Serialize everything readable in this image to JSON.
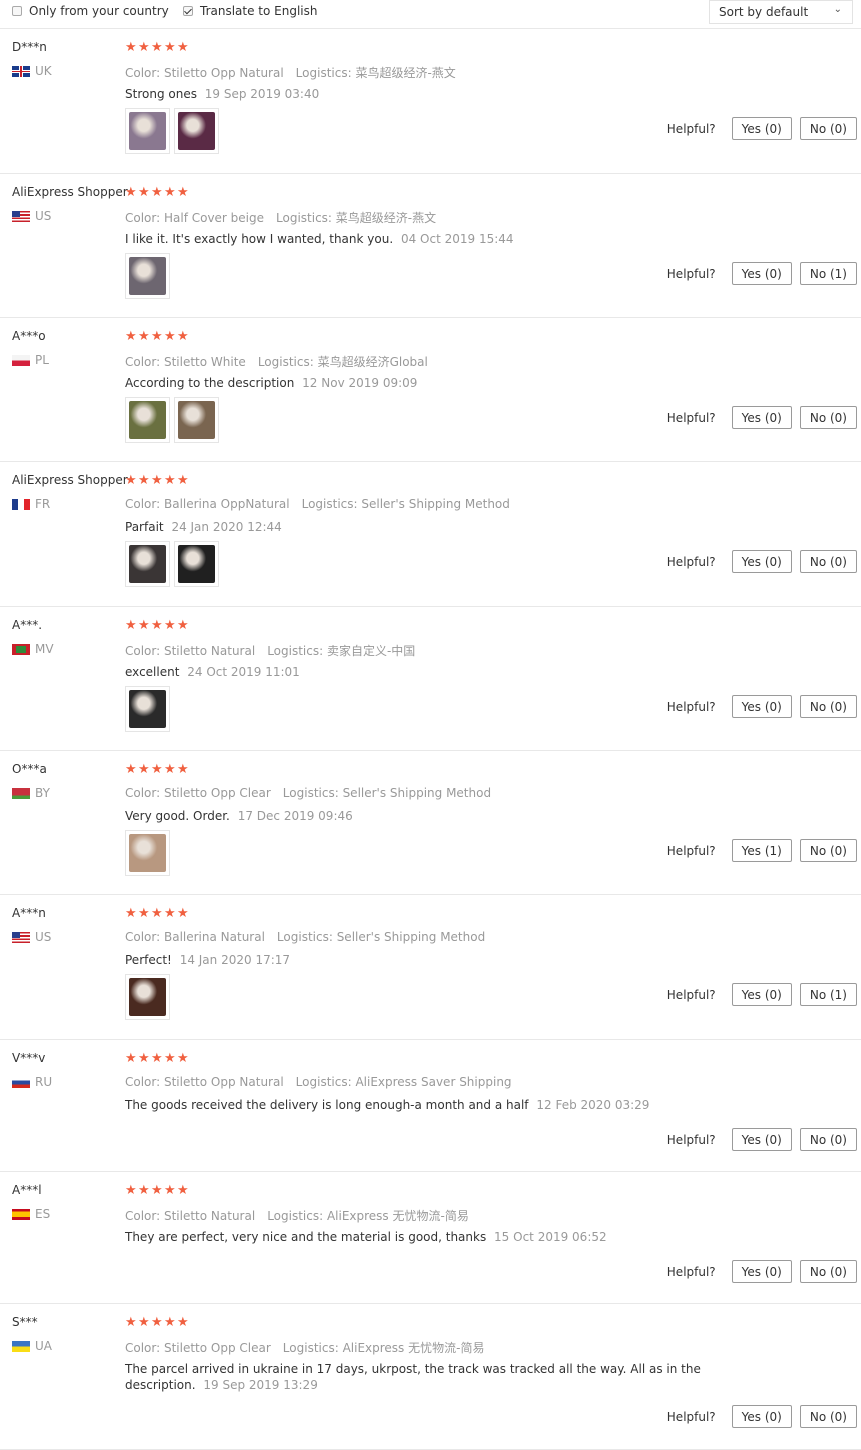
{
  "filters": {
    "country_label": "Only from your country",
    "country_checked": false,
    "translate_label": "Translate to English",
    "translate_checked": true,
    "sort_value": "Sort by default"
  },
  "helpful_label": "Helpful?",
  "reviews": [
    {
      "user": "D***n",
      "country": "UK",
      "flag": "uk",
      "stars": 5,
      "color": "Color: Stiletto Opp Natural",
      "logistics": "Logistics: 菜鸟超级经济-燕文",
      "comment": "Strong ones",
      "date": "19 Sep 2019 03:40",
      "thumbs": [
        "#8a7890",
        "#5a2a45"
      ],
      "yes": "Yes (0)",
      "no": "No (0)"
    },
    {
      "user": "AliExpress Shopper",
      "country": "US",
      "flag": "us",
      "stars": 5,
      "color": "Color: Half Cover beige",
      "logistics": "Logistics: 菜鸟超级经济-燕文",
      "comment": "I like it. It's exactly how I wanted, thank you.",
      "date": "04 Oct 2019 15:44",
      "thumbs": [
        "#6d6670"
      ],
      "yes": "Yes (0)",
      "no": "No (1)"
    },
    {
      "user": "A***o",
      "country": "PL",
      "flag": "pl",
      "stars": 5,
      "color": "Color: Stiletto White",
      "logistics": "Logistics: 菜鸟超级经济Global",
      "comment": "According to the description",
      "date": "12 Nov 2019 09:09",
      "thumbs": [
        "#6a7040",
        "#7a6550"
      ],
      "yes": "Yes (0)",
      "no": "No (0)"
    },
    {
      "user": "AliExpress Shopper",
      "country": "FR",
      "flag": "fr",
      "stars": 5,
      "color": "Color: Ballerina OppNatural",
      "logistics": "Logistics: Seller's Shipping Method",
      "comment": "Parfait",
      "date": "24 Jan 2020 12:44",
      "thumbs": [
        "#3a3535",
        "#202020"
      ],
      "yes": "Yes (0)",
      "no": "No (0)"
    },
    {
      "user": "A***.",
      "country": "MV",
      "flag": "mv",
      "stars": 5,
      "color": "Color: Stiletto Natural",
      "logistics": "Logistics: 卖家自定义-中国",
      "comment": "excellent",
      "date": "24 Oct 2019 11:01",
      "thumbs": [
        "#2a2a2a"
      ],
      "yes": "Yes (0)",
      "no": "No (0)"
    },
    {
      "user": "O***a",
      "country": "BY",
      "flag": "by",
      "stars": 5,
      "color": "Color: Stiletto Opp Clear",
      "logistics": "Logistics: Seller's Shipping Method",
      "comment": "Very good. Order.",
      "date": "17 Dec 2019 09:46",
      "thumbs": [
        "#b89880"
      ],
      "yes": "Yes (1)",
      "no": "No (0)"
    },
    {
      "user": "A***n",
      "country": "US",
      "flag": "us",
      "stars": 5,
      "color": "Color: Ballerina Natural",
      "logistics": "Logistics: Seller's Shipping Method",
      "comment": "Perfect!",
      "date": "14 Jan 2020 17:17",
      "thumbs": [
        "#4a2a20"
      ],
      "yes": "Yes (0)",
      "no": "No (1)"
    },
    {
      "user": "V***v",
      "country": "RU",
      "flag": "ru",
      "stars": 5,
      "color": "Color: Stiletto Opp Natural",
      "logistics": "Logistics: AliExpress Saver Shipping",
      "comment": "The goods received the delivery is long enough-a month and a half",
      "date": "12 Feb 2020 03:29",
      "thumbs": [],
      "yes": "Yes (0)",
      "no": "No (0)"
    },
    {
      "user": "A***l",
      "country": "ES",
      "flag": "es",
      "stars": 5,
      "color": "Color: Stiletto Natural",
      "logistics": "Logistics: AliExpress 无忧物流-简易",
      "comment": "They are perfect, very nice and the material is good, thanks",
      "date": "15 Oct 2019 06:52",
      "thumbs": [],
      "yes": "Yes (0)",
      "no": "No (0)"
    },
    {
      "user": "S***",
      "country": "UA",
      "flag": "ua",
      "stars": 5,
      "color": "Color: Stiletto Opp Clear",
      "logistics": "Logistics: AliExpress 无忧物流-简易",
      "comment": "The parcel arrived in ukraine in 17 days, ukrpost, the track was tracked all the way. All as in the description.",
      "date": "19 Sep 2019 13:29",
      "thumbs": [],
      "yes": "Yes (0)",
      "no": "No (0)"
    }
  ]
}
